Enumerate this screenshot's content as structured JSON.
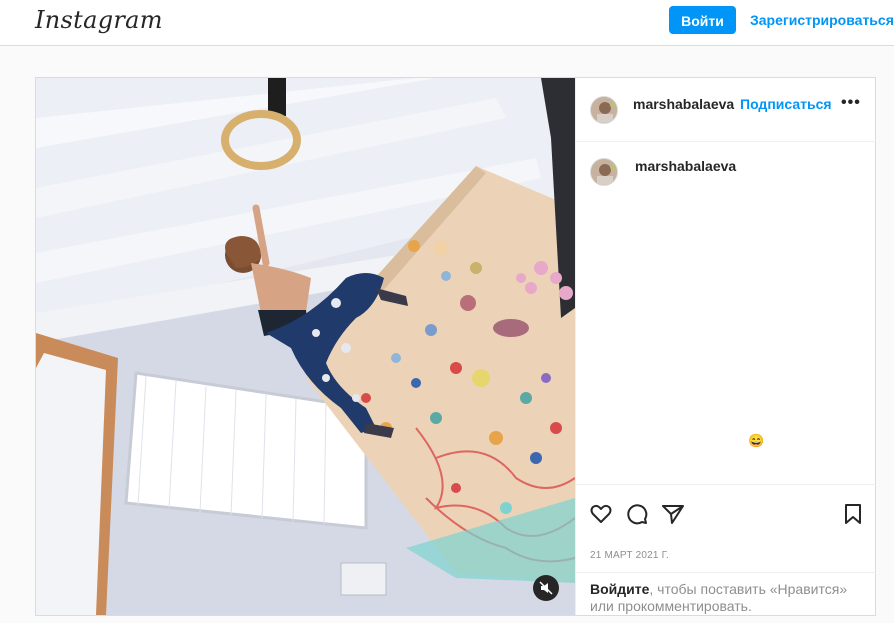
{
  "header": {
    "logo_text": "Instagram",
    "login_label": "Войти",
    "signup_label": "Зарегистрироваться"
  },
  "post": {
    "author": "marshabalaeva",
    "follow_label": "Подписаться",
    "more_icon": "more-options-icon",
    "caption_author": "marshabalaeva",
    "caption_emoji": "😄",
    "date": "21 МАРТ 2021 Г.",
    "login_prompt": {
      "link": "Войдите",
      "text": ", чтобы поставить «Нравится» или прокомментировать."
    },
    "icons": [
      "heart-icon",
      "comment-icon",
      "share-icon",
      "bookmark-icon",
      "mute-icon"
    ]
  },
  "colors": {
    "accent": "#0095f6",
    "border": "#dbdbdb",
    "muted_text": "#8e8e8e"
  }
}
